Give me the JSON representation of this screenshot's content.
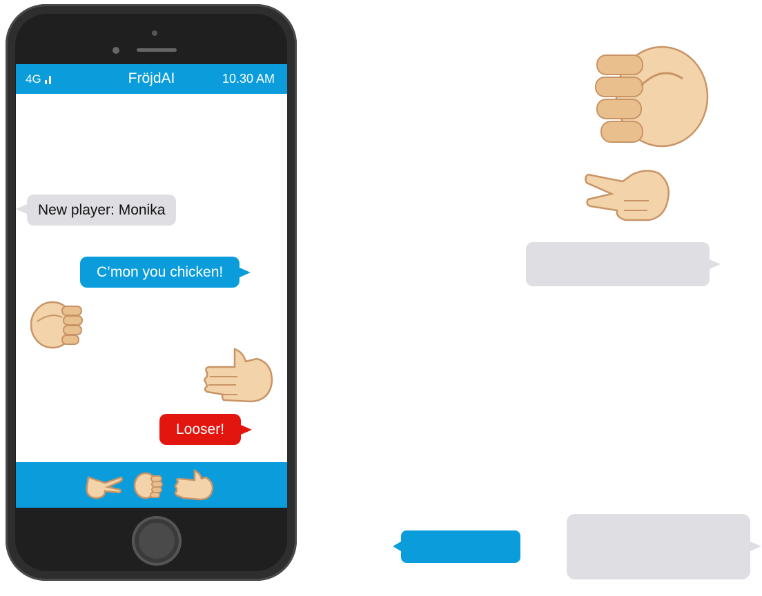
{
  "status_bar": {
    "network": "4G",
    "app_title": "FröjdAI",
    "time": "10.30 AM"
  },
  "messages": [
    {
      "text": "New player: Monika"
    },
    {
      "text": "C’mon you chicken!"
    },
    {
      "text": "Looser!"
    }
  ],
  "bottom_bar": {
    "choices": [
      "scissors-icon",
      "rock-icon",
      "paper-icon"
    ]
  },
  "colors": {
    "accent": "#0b9ddb",
    "incoming_bubble": "#dfdee3",
    "alert_bubble": "#e3150f",
    "phone_body": "#2e2e2e"
  }
}
